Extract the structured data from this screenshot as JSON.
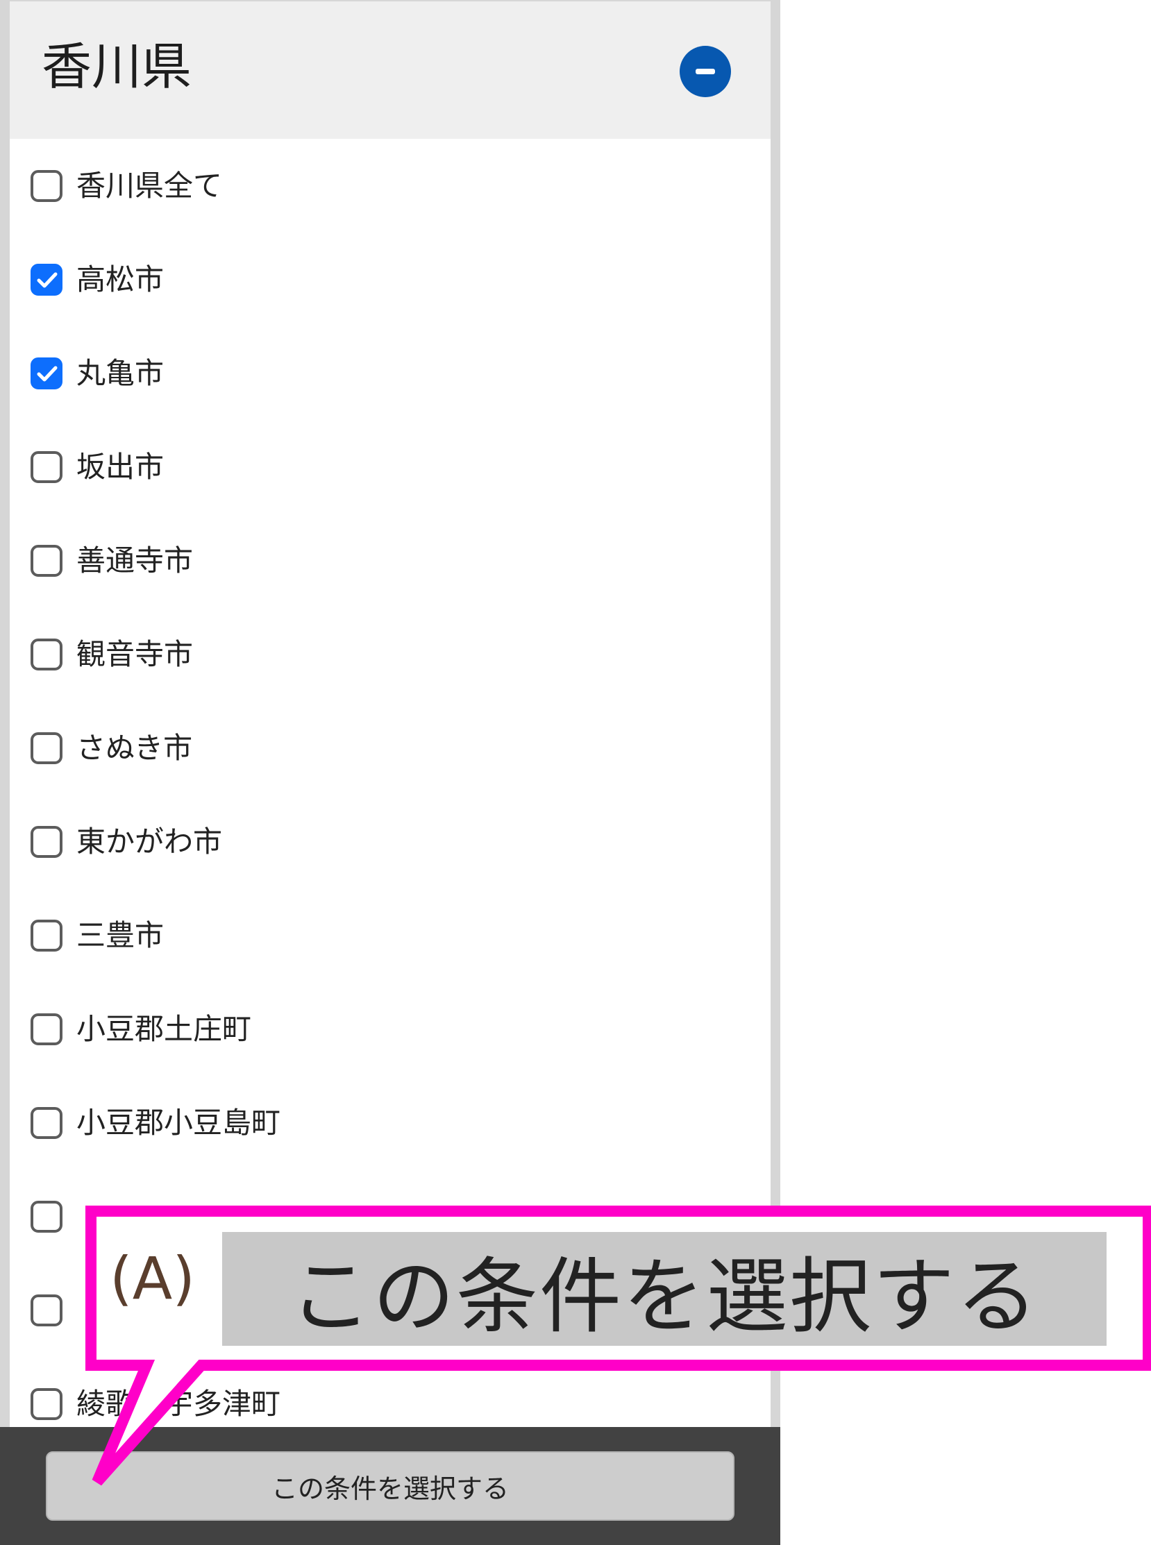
{
  "header": {
    "title": "香川県",
    "collapse_icon": "minus-circle-icon"
  },
  "items": [
    {
      "label": "香川県全て",
      "checked": false
    },
    {
      "label": "高松市",
      "checked": true
    },
    {
      "label": "丸亀市",
      "checked": true
    },
    {
      "label": "坂出市",
      "checked": false
    },
    {
      "label": "善通寺市",
      "checked": false
    },
    {
      "label": "観音寺市",
      "checked": false
    },
    {
      "label": "さぬき市",
      "checked": false
    },
    {
      "label": "東かがわ市",
      "checked": false
    },
    {
      "label": "三豊市",
      "checked": false
    },
    {
      "label": "小豆郡土庄町",
      "checked": false
    },
    {
      "label": "小豆郡小豆島町",
      "checked": false
    },
    {
      "label": "",
      "checked": false
    },
    {
      "label": "",
      "checked": false
    },
    {
      "label": "綾歌郡宇多津町",
      "checked": false
    }
  ],
  "footer": {
    "submit_label": "この条件を選択する"
  },
  "callout": {
    "label": "(A)",
    "text": "この条件を選択する"
  },
  "colors": {
    "accent": "#0d6efd",
    "collapse": "#0758b0",
    "callout": "#ff00c8",
    "footer": "#424242"
  }
}
